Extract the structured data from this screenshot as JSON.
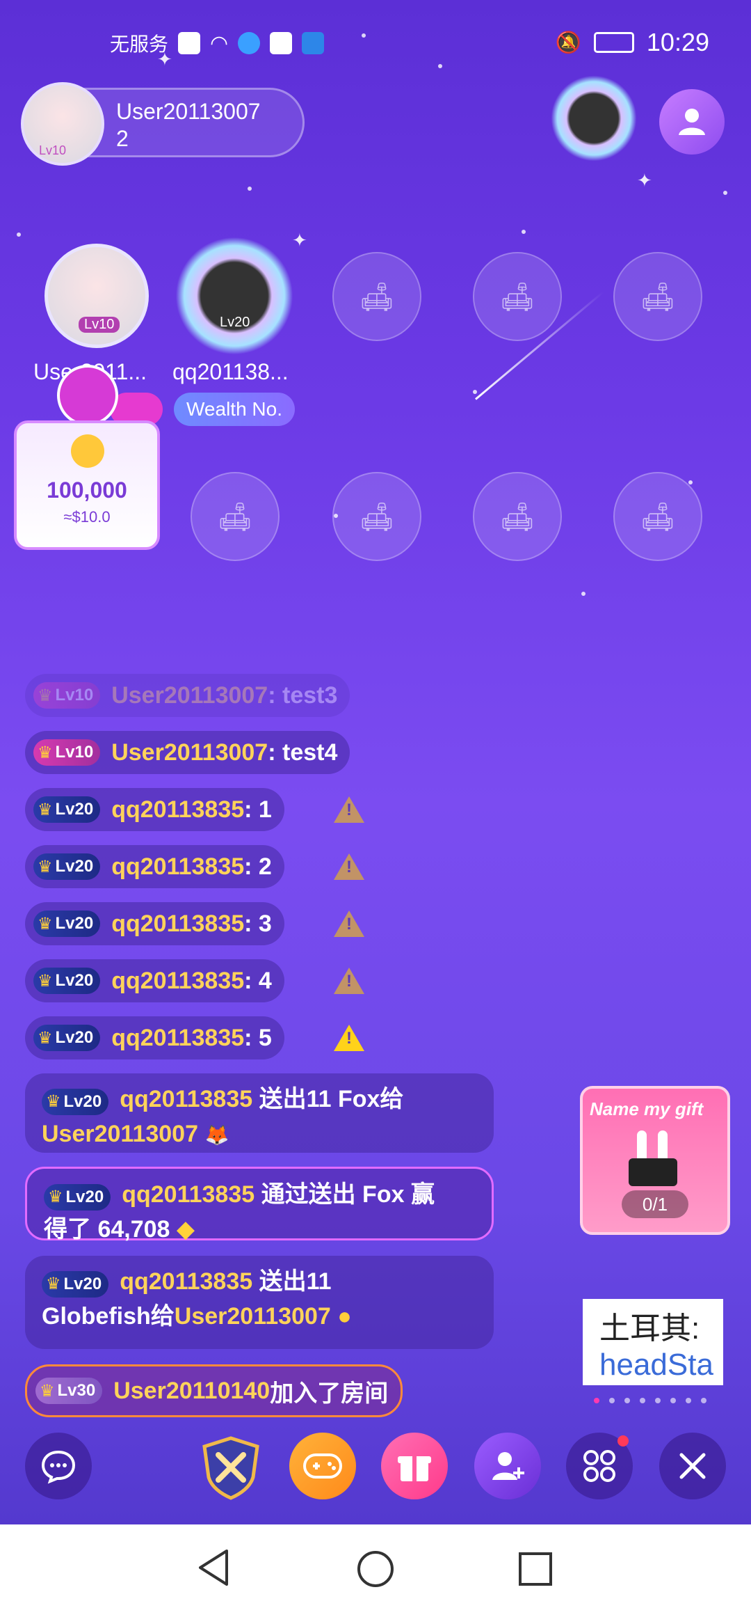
{
  "status_bar": {
    "carrier": "无服务",
    "time": "10:29"
  },
  "host": {
    "name": "User20113007",
    "count": "2",
    "level": "Lv10"
  },
  "seats_row1": [
    {
      "name": "User2011...",
      "level": "Lv10"
    },
    {
      "name": "qq201138...",
      "level": "Lv20",
      "tag": "Wealth No."
    }
  ],
  "bean_card": {
    "value": "100,000",
    "sub": "≈$10.0"
  },
  "chat": [
    {
      "level": "Lv10",
      "user": "User20113007",
      "text": " : test3"
    },
    {
      "level": "Lv10",
      "user": "User20113007",
      "text": " : test4"
    },
    {
      "level": "Lv20",
      "user": "qq20113835",
      "text": " : 1"
    },
    {
      "level": "Lv20",
      "user": "qq20113835",
      "text": " : 2"
    },
    {
      "level": "Lv20",
      "user": "qq20113835",
      "text": " : 3"
    },
    {
      "level": "Lv20",
      "user": "qq20113835",
      "text": " : 4"
    },
    {
      "level": "Lv20",
      "user": "qq20113835",
      "text": " : 5"
    }
  ],
  "sys_messages": [
    {
      "level": "Lv20",
      "user": "qq20113835",
      "line1": " 送出11 Fox给",
      "line2": "User20113007"
    },
    {
      "level": "Lv20",
      "user": "qq20113835",
      "line1": " 通过送出 Fox 赢",
      "line2": "得了 64,708"
    },
    {
      "level": "Lv20",
      "user": "qq20113835",
      "line1": " 送出11",
      "line2a": "Globefish给",
      "line2b": "User20113007"
    }
  ],
  "join_message": {
    "level": "Lv30",
    "user": "User20110140",
    "text": " 加入了房间"
  },
  "name_gift": {
    "title": "Name my gift",
    "count": "0/1"
  },
  "ticker": {
    "line1": "土耳其:",
    "line2": "headSta"
  },
  "icons": {
    "chat": "chat-bubble-icon",
    "game": "gamepad-icon",
    "gift": "gift-icon",
    "invite": "add-user-icon",
    "more": "grid-icon",
    "close": "close-icon"
  }
}
